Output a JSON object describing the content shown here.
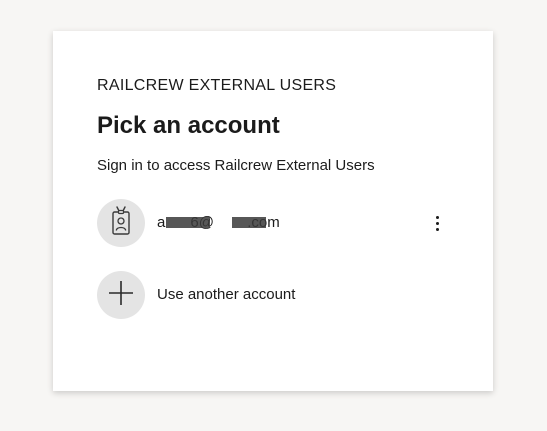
{
  "card": {
    "brand": "RAILCREW EXTERNAL USERS",
    "title": "Pick an account",
    "subtitle": "Sign in to access Railcrew External Users"
  },
  "accounts": [
    {
      "email": "a      6@        .com",
      "avatar_icon": "id-badge-icon",
      "menu_icon": "more-options-icon"
    }
  ],
  "other_account": {
    "label": "Use another account",
    "icon": "plus-icon"
  },
  "colors": {
    "background": "#f7f6f4",
    "card": "#ffffff",
    "avatar_bg": "#e4e4e4",
    "text": "#1b1b1b"
  }
}
